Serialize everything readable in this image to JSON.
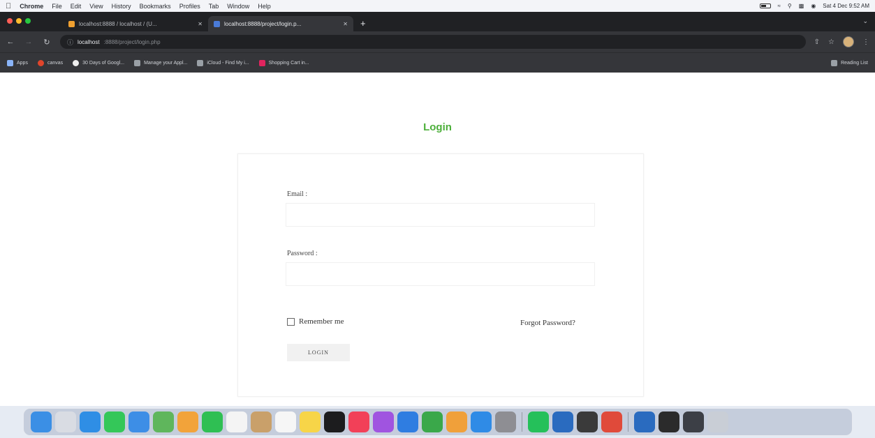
{
  "menubar": {
    "items": [
      "Chrome",
      "File",
      "Edit",
      "View",
      "History",
      "Bookmarks",
      "Profiles",
      "Tab",
      "Window",
      "Help"
    ],
    "datetime": "Sat 4 Dec 9:52 AM"
  },
  "tabs": [
    {
      "title": "localhost:8888 / localhost / (U...",
      "icon_color": "#f0a030"
    },
    {
      "title": "localhost:8888/project/login.p...",
      "icon_color": "#4a7bd8"
    }
  ],
  "toolbar": {
    "url_host": "localhost",
    "url_path": ":8888/project/login.php"
  },
  "bookmarks": [
    {
      "label": "Apps",
      "color": "#8ab4f8"
    },
    {
      "label": "canvas",
      "color": "#e0452b"
    },
    {
      "label": "30 Days of Googl...",
      "color": "#eeeeee"
    },
    {
      "label": "Manage your Appl...",
      "color": "#9aa0a6"
    },
    {
      "label": "iCloud - Find My i...",
      "color": "#9aa0a6"
    },
    {
      "label": "Shopping Cart in...",
      "color": "#e0245e"
    }
  ],
  "reading_list": "Reading List",
  "page": {
    "title": "Login",
    "email_label": "Email :",
    "password_label": "Password :",
    "remember_label": "Remember me",
    "forgot_label": "Forgot Password?",
    "login_button": "LOGIN"
  },
  "colors": {
    "accent": "#4caf3a"
  },
  "dock": [
    {
      "name": "finder-icon",
      "color": "#3b8fe5"
    },
    {
      "name": "launchpad-icon",
      "color": "#d9dce3"
    },
    {
      "name": "safari-icon",
      "color": "#2f8ee5"
    },
    {
      "name": "messages-icon",
      "color": "#34c759"
    },
    {
      "name": "mail-icon",
      "color": "#3d8ee6"
    },
    {
      "name": "maps-icon",
      "color": "#5fb65c"
    },
    {
      "name": "photos-icon",
      "color": "#f2a33a"
    },
    {
      "name": "facetime-icon",
      "color": "#2fbf53"
    },
    {
      "name": "calendar-icon",
      "color": "#f4f4f4"
    },
    {
      "name": "contacts-icon",
      "color": "#c9a06a"
    },
    {
      "name": "reminders-icon",
      "color": "#f6f6f6"
    },
    {
      "name": "notes-icon",
      "color": "#f7d548"
    },
    {
      "name": "tv-icon",
      "color": "#1c1c1e"
    },
    {
      "name": "music-icon",
      "color": "#f24058"
    },
    {
      "name": "podcasts-icon",
      "color": "#a054e0"
    },
    {
      "name": "keynote-icon",
      "color": "#2f7de1"
    },
    {
      "name": "numbers-icon",
      "color": "#3aa84a"
    },
    {
      "name": "pages-icon",
      "color": "#f0a03a"
    },
    {
      "name": "app-store-icon",
      "color": "#2f8be6"
    },
    {
      "name": "system-preferences-icon",
      "color": "#8e8e93"
    },
    {
      "name": "whatsapp-icon",
      "color": "#25c05a"
    },
    {
      "name": "virtualbox-icon",
      "color": "#2a6bbf"
    },
    {
      "name": "mamp-icon",
      "color": "#3a3a3a"
    },
    {
      "name": "chrome-icon",
      "color": "#e04a3a"
    },
    {
      "name": "virtualbox-2-icon",
      "color": "#2a6bbf"
    },
    {
      "name": "terminal-icon",
      "color": "#2b2b2b"
    },
    {
      "name": "window-thumbnail-icon",
      "color": "#3c3f46"
    },
    {
      "name": "trash-icon",
      "color": "#c9ced6"
    }
  ]
}
